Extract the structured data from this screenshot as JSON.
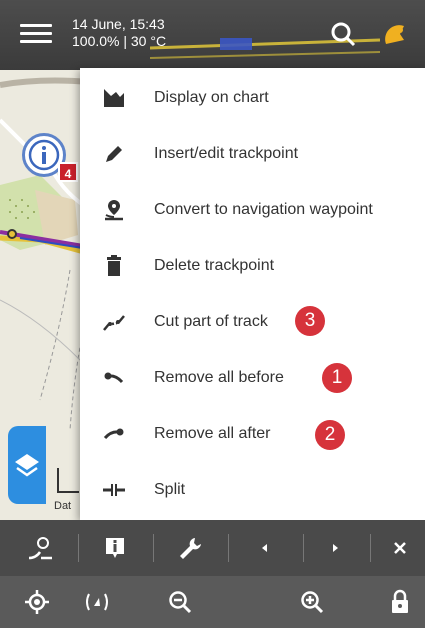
{
  "status": {
    "datetime": "14 June, 15:43",
    "stats": "100.0% | 30 °C"
  },
  "info_badge": "4",
  "scale_label": "Dat",
  "menu": {
    "items": [
      {
        "label": "Display on chart",
        "icon": "chart-icon"
      },
      {
        "label": "Insert/edit trackpoint",
        "icon": "pencil-icon"
      },
      {
        "label": "Convert to navigation waypoint",
        "icon": "navigation-waypoint-icon"
      },
      {
        "label": "Delete trackpoint",
        "icon": "trash-icon"
      },
      {
        "label": "Cut part of track",
        "icon": "cut-track-icon",
        "badge": "3"
      },
      {
        "label": "Remove all before",
        "icon": "remove-before-icon",
        "badge": "1"
      },
      {
        "label": "Remove all after",
        "icon": "remove-after-icon",
        "badge": "2"
      },
      {
        "label": "Split",
        "icon": "split-icon"
      }
    ]
  },
  "toolbar_top": [
    "track-point-icon",
    "info-icon",
    "wrench-icon",
    "previous-icon",
    "next-icon",
    "close-icon"
  ],
  "toolbar_bottom": [
    "locate-icon",
    "rotate-icon",
    "zoom-out-icon",
    "zoom-in-icon",
    "lock-icon"
  ],
  "colors": {
    "accent": "#2d8ee0",
    "badge": "#d6333b",
    "toolbar": "#4a4a4a",
    "gps": "#f0b020"
  }
}
